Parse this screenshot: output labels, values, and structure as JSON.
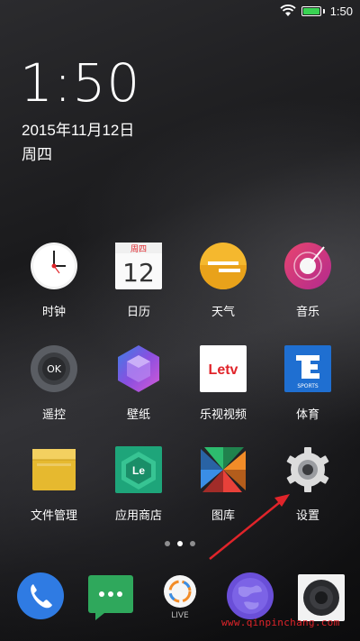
{
  "status_bar": {
    "time": "1:50"
  },
  "clock": {
    "time": "1:50",
    "date": "2015年11月12日",
    "weekday": "周四"
  },
  "apps": [
    {
      "label": "时钟",
      "icon": "clock-icon"
    },
    {
      "label": "日历",
      "icon": "calendar-icon",
      "cal_header": "周四",
      "cal_day": "12"
    },
    {
      "label": "天气",
      "icon": "weather-icon"
    },
    {
      "label": "音乐",
      "icon": "music-icon"
    },
    {
      "label": "遥控",
      "icon": "remote-icon",
      "badge": "OK"
    },
    {
      "label": "壁纸",
      "icon": "wallpaper-icon"
    },
    {
      "label": "乐视视频",
      "icon": "letv-video-icon",
      "logo": "Letv"
    },
    {
      "label": "体育",
      "icon": "sports-icon",
      "sub": "SPORTS"
    },
    {
      "label": "文件管理",
      "icon": "folder-icon"
    },
    {
      "label": "应用商店",
      "icon": "app-store-icon",
      "logo": "Le"
    },
    {
      "label": "图库",
      "icon": "gallery-icon"
    },
    {
      "label": "设置",
      "icon": "settings-icon"
    }
  ],
  "dock": [
    {
      "icon": "phone-icon"
    },
    {
      "icon": "messages-icon"
    },
    {
      "icon": "live-icon",
      "label": "LIVE"
    },
    {
      "icon": "browser-icon"
    },
    {
      "icon": "camera-icon"
    }
  ],
  "watermark": "www.qinpinchang.com",
  "colors": {
    "accent_red": "#e0242a",
    "battery": "#39d353"
  }
}
